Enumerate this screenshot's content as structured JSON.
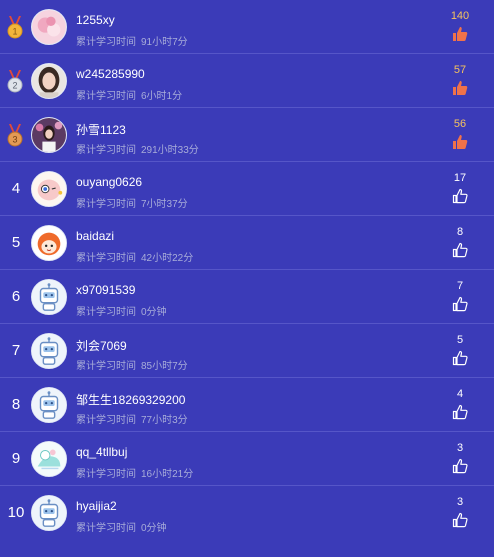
{
  "leaderboard": {
    "time_label": "累计学习时间",
    "rows": [
      {
        "rank": "1",
        "name": "1255xy",
        "time": "91小时7分",
        "likes": "140",
        "medal": "gold",
        "avatar": "pink-flower-avatar"
      },
      {
        "rank": "2",
        "name": "w245285990",
        "time": "6小时1分",
        "likes": "57",
        "medal": "silver",
        "avatar": "girl-photo-avatar"
      },
      {
        "rank": "3",
        "name": "孙雪1123",
        "time": "291小时33分",
        "likes": "56",
        "medal": "bronze",
        "avatar": "girl-flowers-avatar"
      },
      {
        "rank": "4",
        "name": "ouyang0626",
        "time": "7小时37分",
        "likes": "17",
        "avatar": "cartoon-bird-avatar"
      },
      {
        "rank": "5",
        "name": "baidazi",
        "time": "42小时22分",
        "likes": "8",
        "avatar": "orange-character-avatar"
      },
      {
        "rank": "6",
        "name": "x97091539",
        "time": "0分钟",
        "likes": "7",
        "avatar": "robot-avatar"
      },
      {
        "rank": "7",
        "name": "刘会7069",
        "time": "85小时7分",
        "likes": "5",
        "avatar": "robot-avatar"
      },
      {
        "rank": "8",
        "name": "邹生生18269329200",
        "time": "77小时3分",
        "likes": "4",
        "avatar": "robot-avatar"
      },
      {
        "rank": "9",
        "name": "qq_4tllbuj",
        "time": "16小时21分",
        "likes": "3",
        "avatar": "cartoon-drawing-avatar"
      },
      {
        "rank": "10",
        "name": "hyaijia2",
        "time": "0分钟",
        "likes": "3",
        "avatar": "robot-avatar"
      }
    ]
  },
  "colors": {
    "background": "#3b3bb8",
    "divider": "#5656c8",
    "top_count": "#f5c35e",
    "top_thumb": "#f0724a",
    "secondary_text": "#a8acd9"
  }
}
